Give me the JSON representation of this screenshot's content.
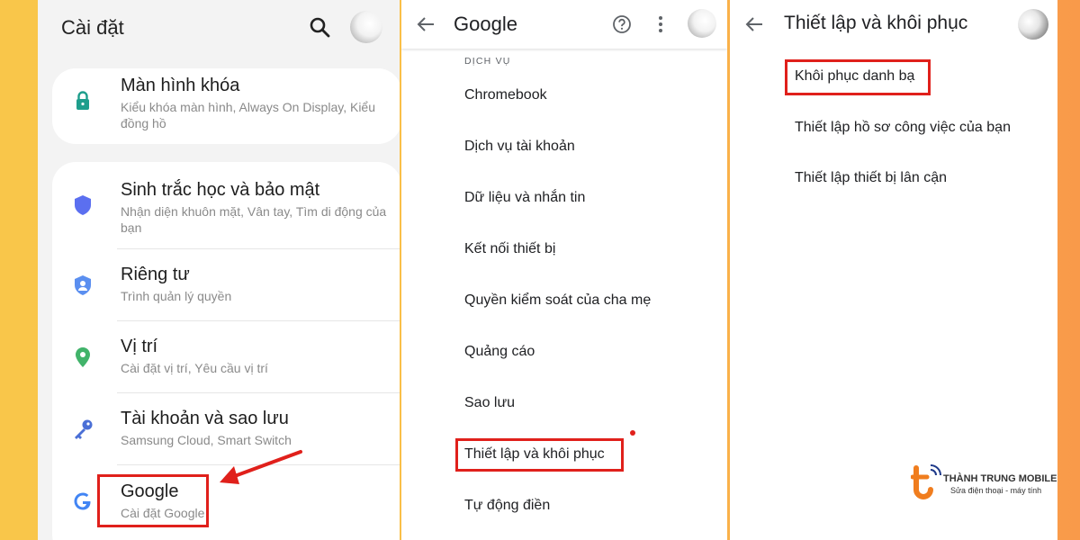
{
  "panel1": {
    "title": "Cài đặt",
    "search_icon": "search-icon",
    "items": [
      {
        "title": "Màn hình khóa",
        "subtitle": "Kiểu khóa màn hình, Always On Display, Kiểu đồng hồ",
        "icon": "lock-icon",
        "color": "#1e9e8c"
      },
      {
        "title": "Sinh trắc học và bảo mật",
        "subtitle": "Nhận diện khuôn mặt, Vân tay, Tìm di động của bạn",
        "icon": "shield-icon",
        "color": "#5b6ff0"
      },
      {
        "title": "Riêng tư",
        "subtitle": "Trình quản lý quyền",
        "icon": "privacy-icon",
        "color": "#5b8ff0"
      },
      {
        "title": "Vị trí",
        "subtitle": "Cài đặt vị trí, Yêu cầu vị trí",
        "icon": "location-pin-icon",
        "color": "#41b36a"
      },
      {
        "title": "Tài khoản và sao lưu",
        "subtitle": "Samsung Cloud, Smart Switch",
        "icon": "key-icon",
        "color": "#4a6fd6"
      },
      {
        "title": "Google",
        "subtitle": "Cài đặt Google",
        "icon": "google-icon",
        "color": "#4285f4"
      }
    ]
  },
  "panel2": {
    "title": "Google",
    "section": "DỊCH VỤ",
    "items": [
      "Chromebook",
      "Dịch vụ tài khoản",
      "Dữ liệu và nhắn tin",
      "Kết nối thiết bị",
      "Quyền kiểm soát của cha mẹ",
      "Quảng cáo",
      "Sao lưu",
      "Thiết lập và khôi phục",
      "Tự động điền"
    ]
  },
  "panel3": {
    "title": "Thiết lập và khôi phục",
    "items": [
      "Khôi phục danh bạ",
      "Thiết lập hồ sơ công việc của bạn",
      "Thiết lập thiết bị lân cận"
    ]
  },
  "logo": {
    "name": "THÀNH TRUNG MOBILE",
    "tagline": "Sửa điện thoại - máy tính"
  },
  "colors": {
    "highlight": "#e0201b",
    "background_left": "#f9c64a",
    "background_right": "#f99a4a"
  }
}
